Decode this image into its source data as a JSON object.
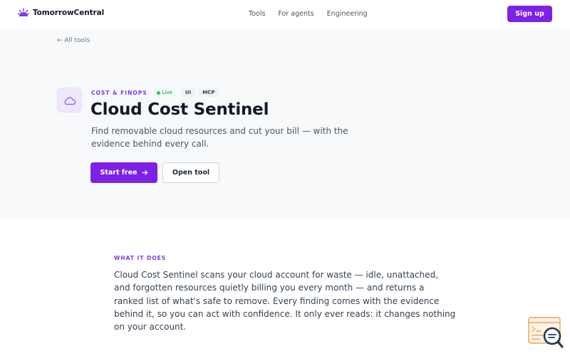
{
  "header": {
    "brand": "TomorrowCentral",
    "nav": [
      "Tools",
      "For agents",
      "Engineering"
    ],
    "signup_label": "Sign up"
  },
  "hero": {
    "back_link": "← All tools",
    "category": "COST & FINOPS",
    "status_badge": "Live",
    "badges": [
      "UI",
      "MCP"
    ],
    "title": "Cloud Cost Sentinel",
    "subtitle": "Find removable cloud resources and cut your bill — with the evidence behind every call.",
    "primary_cta": "Start free",
    "primary_cta_icon": "arrow-right-icon",
    "secondary_cta": "Open tool",
    "tool_icon": "cloud-icon"
  },
  "what_it_does": {
    "label": "WHAT IT DOES",
    "body": "Cloud Cost Sentinel scans your cloud account for waste — idle, unattached, and forgotten resources quietly billing you every month — and returns a ranked list of what's safe to remove. Every finding comes with the evidence behind it, so you can act with confidence. It only ever reads: it changes nothing on your account."
  },
  "colors": {
    "accent": "#7c22e6",
    "category": "#7c3aed",
    "live": "#22c55e",
    "hero_bg": "#f8f9fa"
  },
  "corner_widget_icon": "terminal-search-icon"
}
